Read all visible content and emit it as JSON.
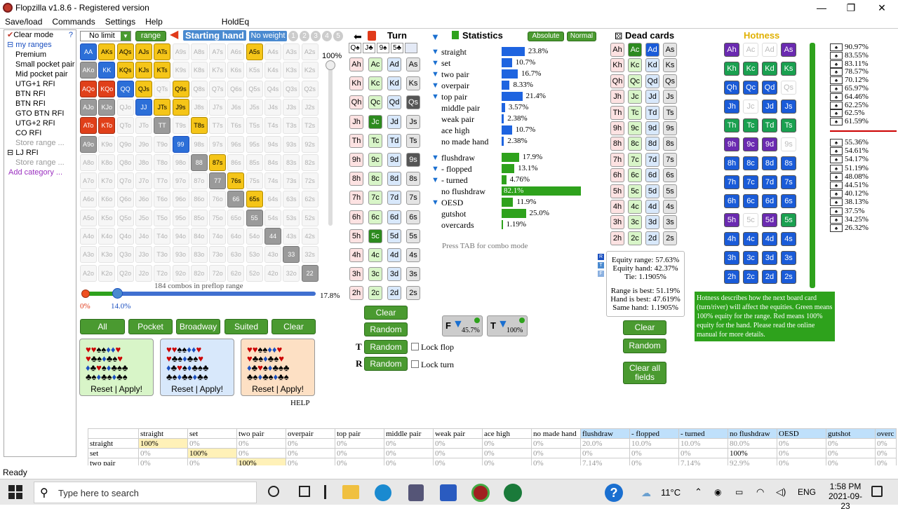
{
  "app": {
    "title": "Flopzilla v1.8.6 - Registered version"
  },
  "menu": [
    "Save/load",
    "Commands",
    "Settings",
    "Help",
    "HoldEq"
  ],
  "sidebar": {
    "clear_mode": "Clear mode",
    "help": "?",
    "items": [
      "my ranges",
      "Premium",
      "Small pocket pair",
      "Mid pocket pair",
      "UTG+1 RFI",
      "BTN RFI",
      "BTN RFI",
      "GTO BTN RFI",
      "UTG+2 RFI",
      "CO RFI",
      "Store range ...",
      "LJ RFI",
      "Store range ...",
      "Add category ..."
    ]
  },
  "range": {
    "limit": "No limit",
    "range_btn": "range",
    "starting_hand": "Starting hand",
    "no_weight": "No weight",
    "weights": [
      "1",
      "2",
      "3",
      "4",
      "5"
    ],
    "pct_top": "100%",
    "combos": "184 combos in preflop range",
    "slider_pct": "17.8%",
    "slider_min": "0%",
    "slider_val": "14.0%"
  },
  "grid": [
    [
      "AA",
      "AKs",
      "AQs",
      "AJs",
      "ATs",
      "A9s",
      "A8s",
      "A7s",
      "A6s",
      "A5s",
      "A4s",
      "A3s",
      "A2s"
    ],
    [
      "AKo",
      "KK",
      "KQs",
      "KJs",
      "KTs",
      "K9s",
      "K8s",
      "K7s",
      "K6s",
      "K5s",
      "K4s",
      "K3s",
      "K2s"
    ],
    [
      "AQo",
      "KQo",
      "QQ",
      "QJs",
      "QTs",
      "Q9s",
      "Q8s",
      "Q7s",
      "Q6s",
      "Q5s",
      "Q4s",
      "Q3s",
      "Q2s"
    ],
    [
      "AJo",
      "KJo",
      "QJo",
      "JJ",
      "JTs",
      "J9s",
      "J8s",
      "J7s",
      "J6s",
      "J5s",
      "J4s",
      "J3s",
      "J2s"
    ],
    [
      "ATo",
      "KTo",
      "QTo",
      "JTo",
      "TT",
      "T9s",
      "T8s",
      "T7s",
      "T6s",
      "T5s",
      "T4s",
      "T3s",
      "T2s"
    ],
    [
      "A9o",
      "K9o",
      "Q9o",
      "J9o",
      "T9o",
      "99",
      "98s",
      "97s",
      "96s",
      "95s",
      "94s",
      "93s",
      "92s"
    ],
    [
      "A8o",
      "K8o",
      "Q8o",
      "J8o",
      "T8o",
      "98o",
      "88",
      "87s",
      "86s",
      "85s",
      "84s",
      "83s",
      "82s"
    ],
    [
      "A7o",
      "K7o",
      "Q7o",
      "J7o",
      "T7o",
      "97o",
      "87o",
      "77",
      "76s",
      "75s",
      "74s",
      "73s",
      "72s"
    ],
    [
      "A6o",
      "K6o",
      "Q6o",
      "J6o",
      "T6o",
      "96o",
      "86o",
      "76o",
      "66",
      "65s",
      "64s",
      "63s",
      "62s"
    ],
    [
      "A5o",
      "K5o",
      "Q5o",
      "J5o",
      "T5o",
      "95o",
      "85o",
      "75o",
      "65o",
      "55",
      "54s",
      "53s",
      "52s"
    ],
    [
      "A4o",
      "K4o",
      "Q4o",
      "J4o",
      "T4o",
      "94o",
      "84o",
      "74o",
      "64o",
      "54o",
      "44",
      "43s",
      "42s"
    ],
    [
      "A3o",
      "K3o",
      "Q3o",
      "J3o",
      "T3o",
      "93o",
      "83o",
      "73o",
      "63o",
      "53o",
      "43o",
      "33",
      "32s"
    ],
    [
      "A2o",
      "K2o",
      "Q2o",
      "J2o",
      "T2o",
      "92o",
      "82o",
      "72o",
      "62o",
      "52o",
      "42o",
      "32o",
      "22"
    ]
  ],
  "filters": {
    "all": "All",
    "pocket": "Pocket",
    "broadway": "Broadway",
    "suited": "Suited",
    "clear": "Clear",
    "reset": "Reset",
    "apply": "Apply!",
    "help": "HELP"
  },
  "board": {
    "title": "Turn",
    "ranks": [
      "A",
      "K",
      "Q",
      "J",
      "T",
      "9",
      "8",
      "7",
      "6",
      "5",
      "4",
      "3",
      "2"
    ],
    "suits": [
      "h",
      "c",
      "d",
      "s"
    ],
    "clear": "Clear",
    "random": "Random",
    "lock_flop": "Lock flop",
    "lock_turn": "Lock turn"
  },
  "stats": {
    "title": "Statistics",
    "absolute": "Absolute",
    "normal": "Normal",
    "rows": [
      {
        "label": "straight",
        "value": "23.8%",
        "pct": 23.8,
        "filter": true
      },
      {
        "label": "set",
        "value": "10.7%",
        "pct": 10.7,
        "filter": true
      },
      {
        "label": "two pair",
        "value": "16.7%",
        "pct": 16.7,
        "filter": true
      },
      {
        "label": "overpair",
        "value": "8.33%",
        "pct": 8.33,
        "filter": true
      },
      {
        "label": "top pair",
        "value": "21.4%",
        "pct": 21.4,
        "filter": true
      },
      {
        "label": "middle pair",
        "value": "3.57%",
        "pct": 3.57,
        "filter": false
      },
      {
        "label": "weak pair",
        "value": "2.38%",
        "pct": 2.38,
        "filter": false
      },
      {
        "label": "ace high",
        "value": "10.7%",
        "pct": 10.7,
        "filter": false
      },
      {
        "label": "no made hand",
        "value": "2.38%",
        "pct": 2.38,
        "filter": false
      }
    ],
    "draws": [
      {
        "label": "flushdraw",
        "value": "17.9%",
        "pct": 17.9,
        "filter": true
      },
      {
        "label": "- flopped",
        "value": "13.1%",
        "pct": 13.1,
        "filter": true
      },
      {
        "label": "- turned",
        "value": "4.76%",
        "pct": 4.76,
        "filter": true
      },
      {
        "label": "no flushdraw",
        "value": "82.1%",
        "pct": 82.1,
        "filter": false
      },
      {
        "label": "OESD",
        "value": "11.9%",
        "pct": 11.9,
        "filter": true
      },
      {
        "label": "gutshot",
        "value": "25.0%",
        "pct": 25.0,
        "filter": false
      },
      {
        "label": "overcards",
        "value": "1.19%",
        "pct": 1.19,
        "filter": false
      }
    ],
    "tab_hint": "Press TAB for combo mode",
    "f_pct": "45.7%",
    "t_pct": "100%"
  },
  "dead": {
    "title": "Dead cards",
    "clear": "Clear",
    "random": "Random",
    "clear_all": "Clear all fields"
  },
  "equity": {
    "range": "Equity range: 57.63%",
    "hand": "Equity hand: 42.37%",
    "tie": "Tie: 1.1905%",
    "range_best": "Range is best: 51.19%",
    "hand_best": "Hand is best: 47.619%",
    "same": "Same hand: 1.1905%"
  },
  "hotness": {
    "title": "Hotness",
    "desc": "Hotness describes how the next board card (turn/river) will affect the equities. Green means 100% equity for the range. Red means 100% equity for the hand. Please read the online manual for more details."
  },
  "right_list": [
    "90.97%",
    "83.55%",
    "83.11%",
    "78.57%",
    "70.12%",
    "65.97%",
    "64.46%",
    "62.25%",
    "62.5%",
    "61.59%",
    "55.36%",
    "54.61%",
    "54.17%",
    "51.19%",
    "48.08%",
    "44.51%",
    "40.12%",
    "38.13%",
    "37.5%",
    "34.25%",
    "26.32%"
  ],
  "table": {
    "headers": [
      "",
      "straight",
      "set",
      "two pair",
      "overpair",
      "top pair",
      "middle pair",
      "weak pair",
      "ace high",
      "no made hand",
      "flushdraw",
      "- flopped",
      "- turned",
      "no flushdraw",
      "OESD",
      "gutshot",
      "overc"
    ],
    "rows": [
      [
        "straight",
        "100%",
        "0%",
        "0%",
        "0%",
        "0%",
        "0%",
        "0%",
        "0%",
        "0%",
        "20.0%",
        "10.0%",
        "10.0%",
        "80.0%",
        "0%",
        "0%",
        "0%"
      ],
      [
        "set",
        "0%",
        "100%",
        "0%",
        "0%",
        "0%",
        "0%",
        "0%",
        "0%",
        "0%",
        "0%",
        "0%",
        "0%",
        "100%",
        "0%",
        "0%",
        "0%"
      ],
      [
        "two pair",
        "0%",
        "0%",
        "100%",
        "0%",
        "0%",
        "0%",
        "0%",
        "0%",
        "0%",
        "7.14%",
        "0%",
        "7.14%",
        "92.9%",
        "0%",
        "0%",
        "0%"
      ]
    ]
  },
  "status": "Ready",
  "taskbar": {
    "search": "Type here to search",
    "temp": "11°C",
    "lang": "ENG",
    "time": "1:58 PM",
    "date": "2021-09-23"
  }
}
